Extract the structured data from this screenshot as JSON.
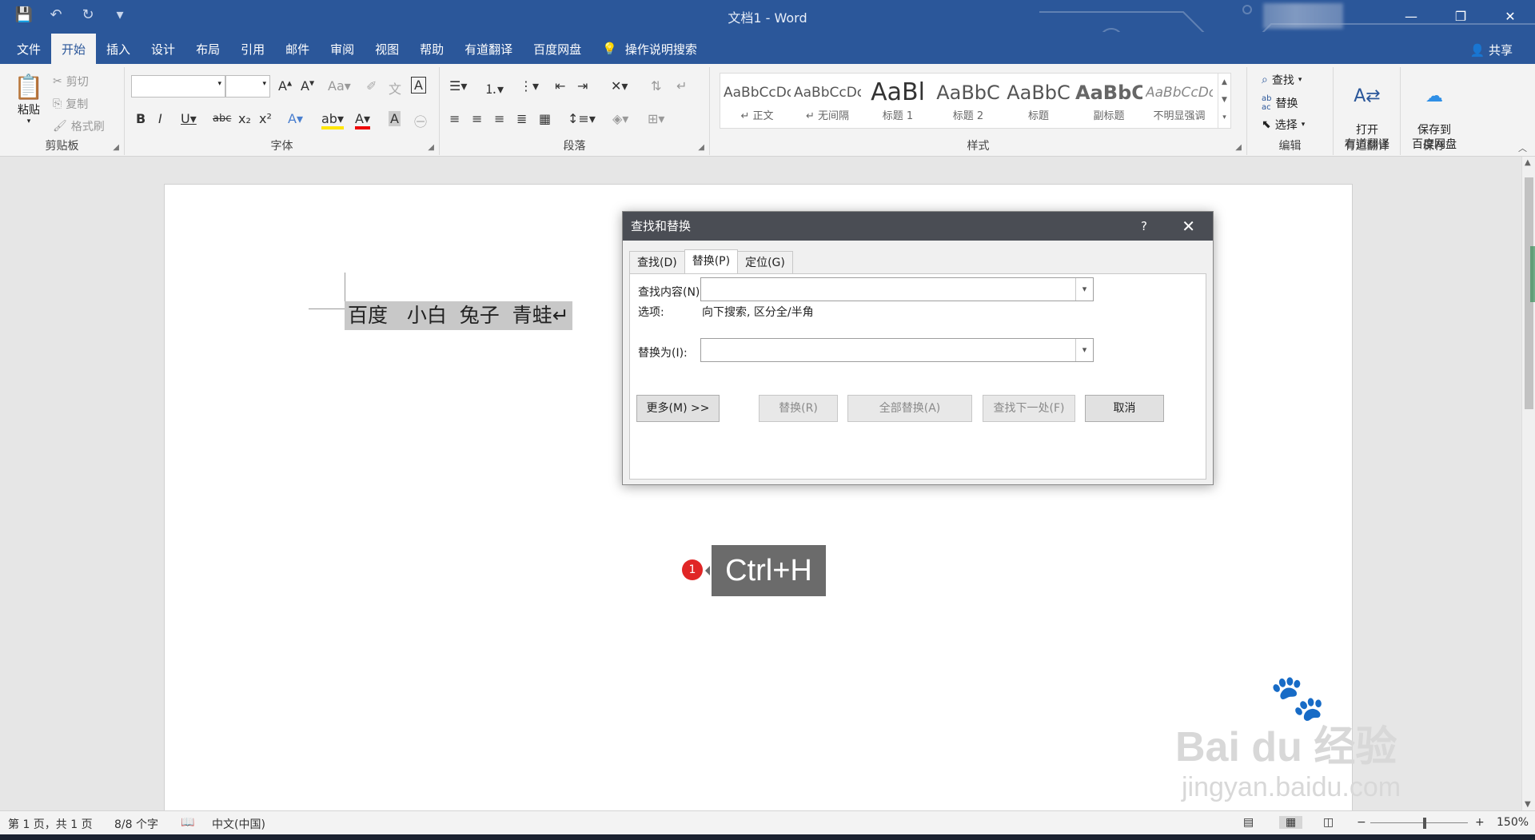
{
  "window": {
    "title": "文档1 - Word"
  },
  "menu_tabs": [
    "文件",
    "开始",
    "插入",
    "设计",
    "布局",
    "引用",
    "邮件",
    "审阅",
    "视图",
    "帮助",
    "有道翻译",
    "百度网盘"
  ],
  "tell_me": "操作说明搜索",
  "share": "共享",
  "clipboard": {
    "paste": "粘贴",
    "cut": "剪切",
    "copy": "复制",
    "format_painter": "格式刷",
    "label": "剪贴板"
  },
  "font_group": {
    "label": "字体",
    "font_name": "",
    "font_size": ""
  },
  "paragraph_group": {
    "label": "段落"
  },
  "styles_group": {
    "label": "样式",
    "items": [
      {
        "preview": "AaBbCcDc",
        "name": "↵ 正文"
      },
      {
        "preview": "AaBbCcDc",
        "name": "↵ 无间隔"
      },
      {
        "preview": "AaBl",
        "name": "标题 1"
      },
      {
        "preview": "AaBbC",
        "name": "标题 2"
      },
      {
        "preview": "AaBbC",
        "name": "标题"
      },
      {
        "preview": "AaBbC",
        "name": "副标题"
      },
      {
        "preview": "AaBbCcDc",
        "name": "不明显强调"
      }
    ]
  },
  "editing_group": {
    "label": "编辑",
    "find": "查找",
    "replace": "替换",
    "select": "选择"
  },
  "youdao_group": {
    "label": "有道翻译",
    "btn": "打开\n有道翻译"
  },
  "save_group": {
    "label": "保存",
    "btn": "保存到\n百度网盘"
  },
  "document": {
    "selected_text": "百度   小白  兔子  青蛙↵"
  },
  "tooltip": {
    "badge": "1",
    "shortcut": "Ctrl+H"
  },
  "dialog": {
    "title": "查找和替换",
    "help": "?",
    "tabs": [
      "查找(D)",
      "替换(P)",
      "定位(G)"
    ],
    "active_tab": "替换(P)",
    "find_label": "查找内容(N):",
    "find_value": "",
    "options_label": "选项:",
    "options_value": "向下搜索, 区分全/半角",
    "replace_label": "替换为(I):",
    "replace_value": "",
    "more_btn": "更多(M) >>",
    "replace_btn": "替换(R)",
    "replace_all_btn": "全部替换(A)",
    "find_next_btn": "查找下一处(F)",
    "cancel_btn": "取消"
  },
  "statusbar": {
    "page": "第 1 页，共 1 页",
    "words": "8/8 个字",
    "lang": "中文(中国)",
    "zoom": "150%"
  },
  "watermark": {
    "logo": "Bai du 经验",
    "url": "jingyan.baidu.com"
  },
  "colors": {
    "word_blue": "#2b579a",
    "dialog_title": "#4a4d54",
    "badge": "#e02626"
  }
}
